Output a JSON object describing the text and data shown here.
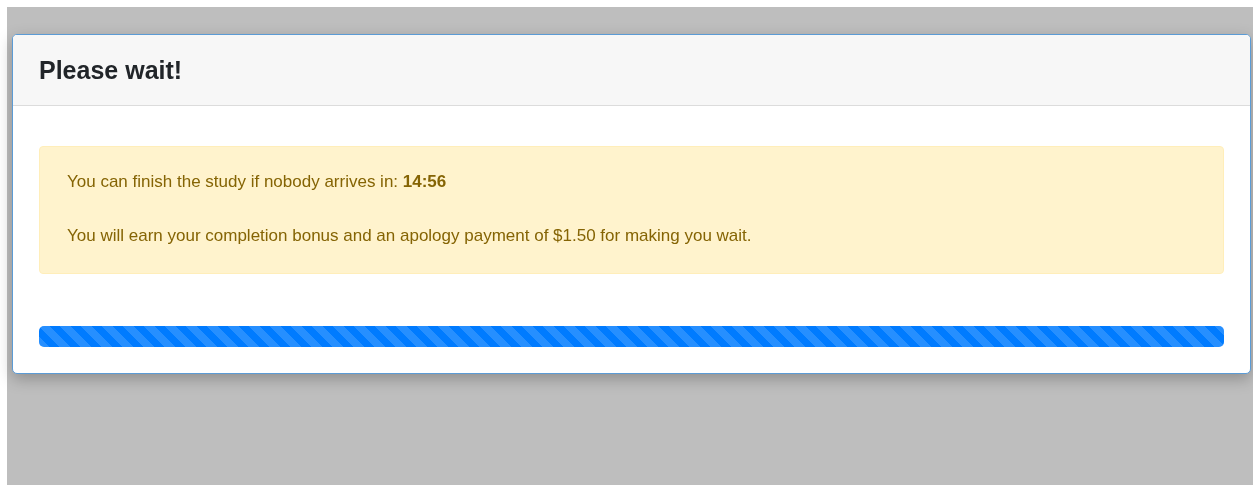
{
  "dialog": {
    "title": "Please wait!",
    "alert": {
      "lines": [
        "You can finish the study if nobody arrives in: **14:56**",
        "You will earn your completion bonus and an apology payment of $1.50 for making you wait."
      ]
    },
    "progress": {
      "level": 1,
      "striped": true
    }
  }
}
